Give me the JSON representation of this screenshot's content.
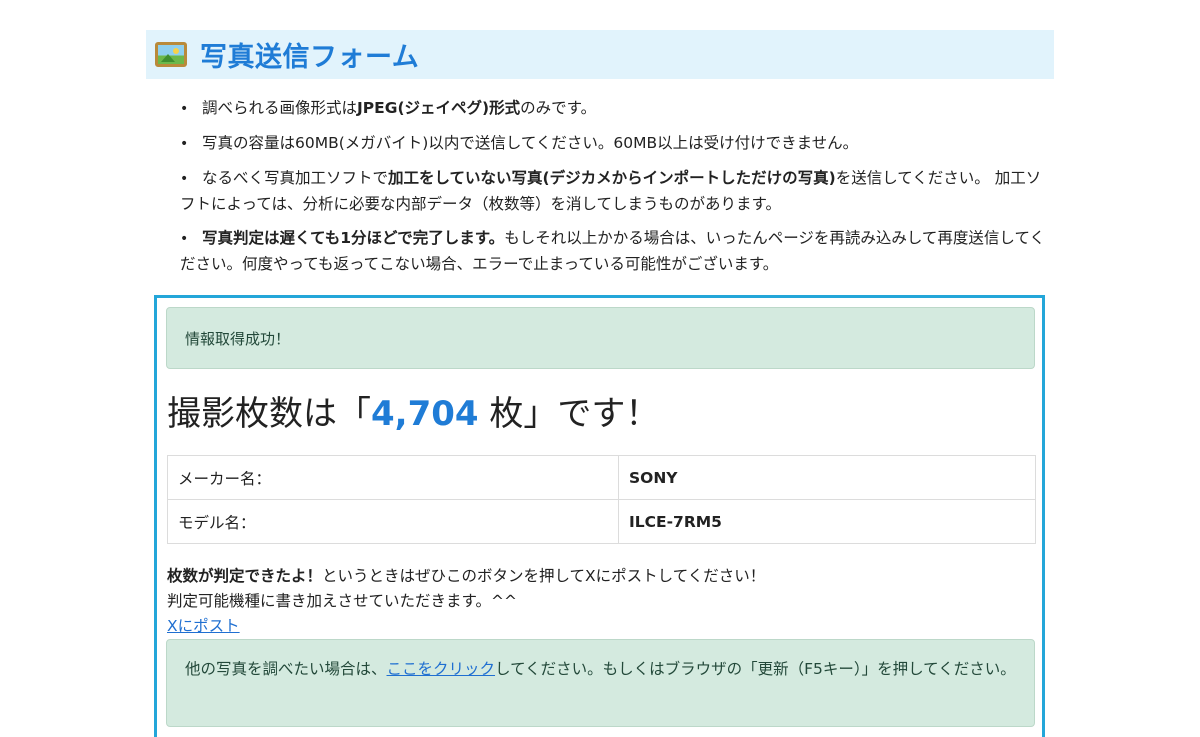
{
  "header": {
    "icon": "framed-picture-icon",
    "title": "写真送信フォーム"
  },
  "notes": [
    {
      "parts": [
        {
          "text": "調べられる画像形式は",
          "bold": false
        },
        {
          "text": "JPEG(ジェイペグ)形式",
          "bold": true
        },
        {
          "text": "のみです。",
          "bold": false
        }
      ]
    },
    {
      "parts": [
        {
          "text": "写真の容量は60MB(メガバイト)以内で送信してください。60MB以上は受け付けできません。",
          "bold": false
        }
      ]
    },
    {
      "parts": [
        {
          "text": "なるべく写真加工ソフトで",
          "bold": false
        },
        {
          "text": "加工をしていない写真(デジカメからインポートしただけの写真)",
          "bold": true
        },
        {
          "text": "を送信してください。 加工ソフトによっては、分析に必要な内部データ（枚数等）を消してしまうものがあります。",
          "bold": false
        }
      ]
    },
    {
      "parts": [
        {
          "text": "写真判定は遅くても1分ほどで完了します。",
          "bold": true
        },
        {
          "text": "もしそれ以上かかる場合は、いったんページを再読み込みして再度送信してください。何度やっても返ってこない場合、エラーで止まっている可能性がございます。",
          "bold": false
        }
      ]
    }
  ],
  "result": {
    "success_message": "情報取得成功！",
    "count_prefix": "撮影枚数は「",
    "count_value": "4,704",
    "count_suffix": " 枚」です！",
    "table": [
      {
        "label": "メーカー名：",
        "value": "SONY"
      },
      {
        "label": "モデル名：",
        "value": "ILCE-7RM5"
      }
    ],
    "cta_bold": "枚数が判定できたよ！",
    "cta_text": "というときはぜひこのボタンを押してXにポストしてください！",
    "cta_line2": "判定可能機種に書き加えさせていただきます。^^",
    "post_link": "Xにポスト",
    "retry_prefix": "他の写真を調べたい場合は、",
    "retry_link": "ここをクリック",
    "retry_suffix": "してください。もしくはブラウザの「更新（F5キー）」を押してください。"
  },
  "colors": {
    "accent": "#1f7cd6",
    "header_bg": "#e1f3fc",
    "box_border": "#23a6d9",
    "alert_bg": "#d4eadf"
  }
}
